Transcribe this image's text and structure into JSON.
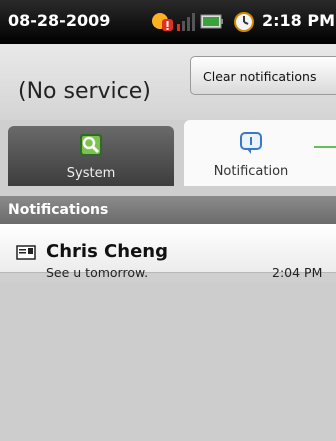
{
  "status_bar": {
    "date": "08-28-2009",
    "time": "2:18 PM",
    "icons": [
      "notification-alert-icon",
      "signal-icon",
      "battery-icon",
      "alarm-icon"
    ]
  },
  "header": {
    "service_text": "(No service)",
    "clear_button_label": "Clear notifications"
  },
  "tabs": [
    {
      "label": "System",
      "icon": "system-icon",
      "selected": false
    },
    {
      "label": "Notification",
      "icon": "notification-icon",
      "selected": true
    }
  ],
  "notifications": {
    "section_title": "Notifications",
    "items": [
      {
        "title": "Chris Cheng",
        "message": "See u tomorrow.",
        "time": "2:04 PM",
        "icon": "message-icon"
      }
    ]
  }
}
